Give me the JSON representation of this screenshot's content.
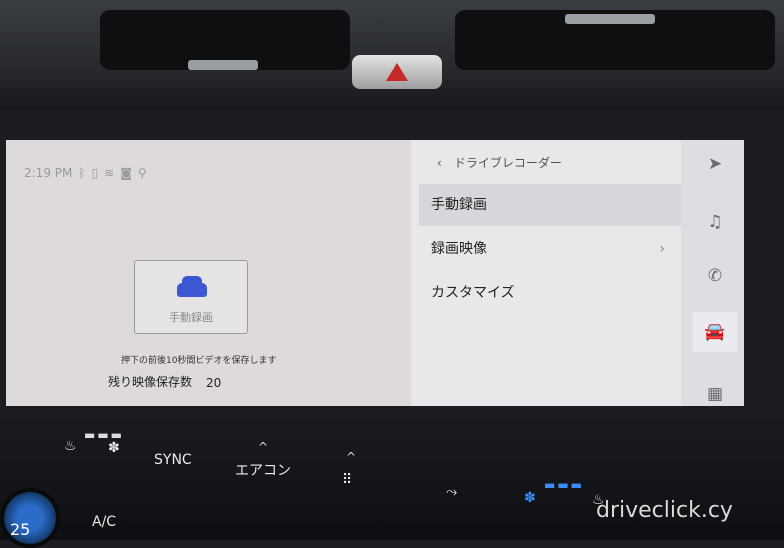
{
  "status": {
    "time": "2:19 PM",
    "icons": [
      "bluetooth-icon",
      "battery-icon",
      "wifi-icon",
      "camera-icon",
      "location-icon"
    ]
  },
  "left_panel": {
    "record_card_label": "手動録画",
    "description": "押下の前後10秒間ビデオを保存します",
    "remaining_label": "残り映像保存数",
    "remaining_value": "20"
  },
  "right_panel": {
    "back_icon": "chevron-left-icon",
    "title": "ドライブレコーダー",
    "menu": [
      {
        "label": "手動録画",
        "selected": true
      },
      {
        "label": "録画映像",
        "has_chevron": true
      },
      {
        "label": "カスタマイズ"
      }
    ],
    "mic_icon": "microphone-icon"
  },
  "side_nav": [
    {
      "icon": "navigation-arrow-icon",
      "glyph": "➤"
    },
    {
      "icon": "music-icon",
      "glyph": "♫"
    },
    {
      "icon": "phone-icon",
      "glyph": "✆"
    },
    {
      "icon": "car-icon",
      "glyph": "🚘",
      "selected": true
    },
    {
      "icon": "apps-grid-icon",
      "glyph": "▦"
    },
    {
      "icon": "settings-icon",
      "glyph": "⚙"
    }
  ],
  "climate": {
    "sync_label": "SYNC",
    "aircon_label": "エアコン",
    "ac_label": "A/C",
    "up_chevron": "^",
    "dots": "⠿",
    "temp": "25"
  },
  "watermark": "driveclick.cy",
  "colors": {
    "accent": "#3550d6",
    "screen_bg": "#dedadb"
  }
}
